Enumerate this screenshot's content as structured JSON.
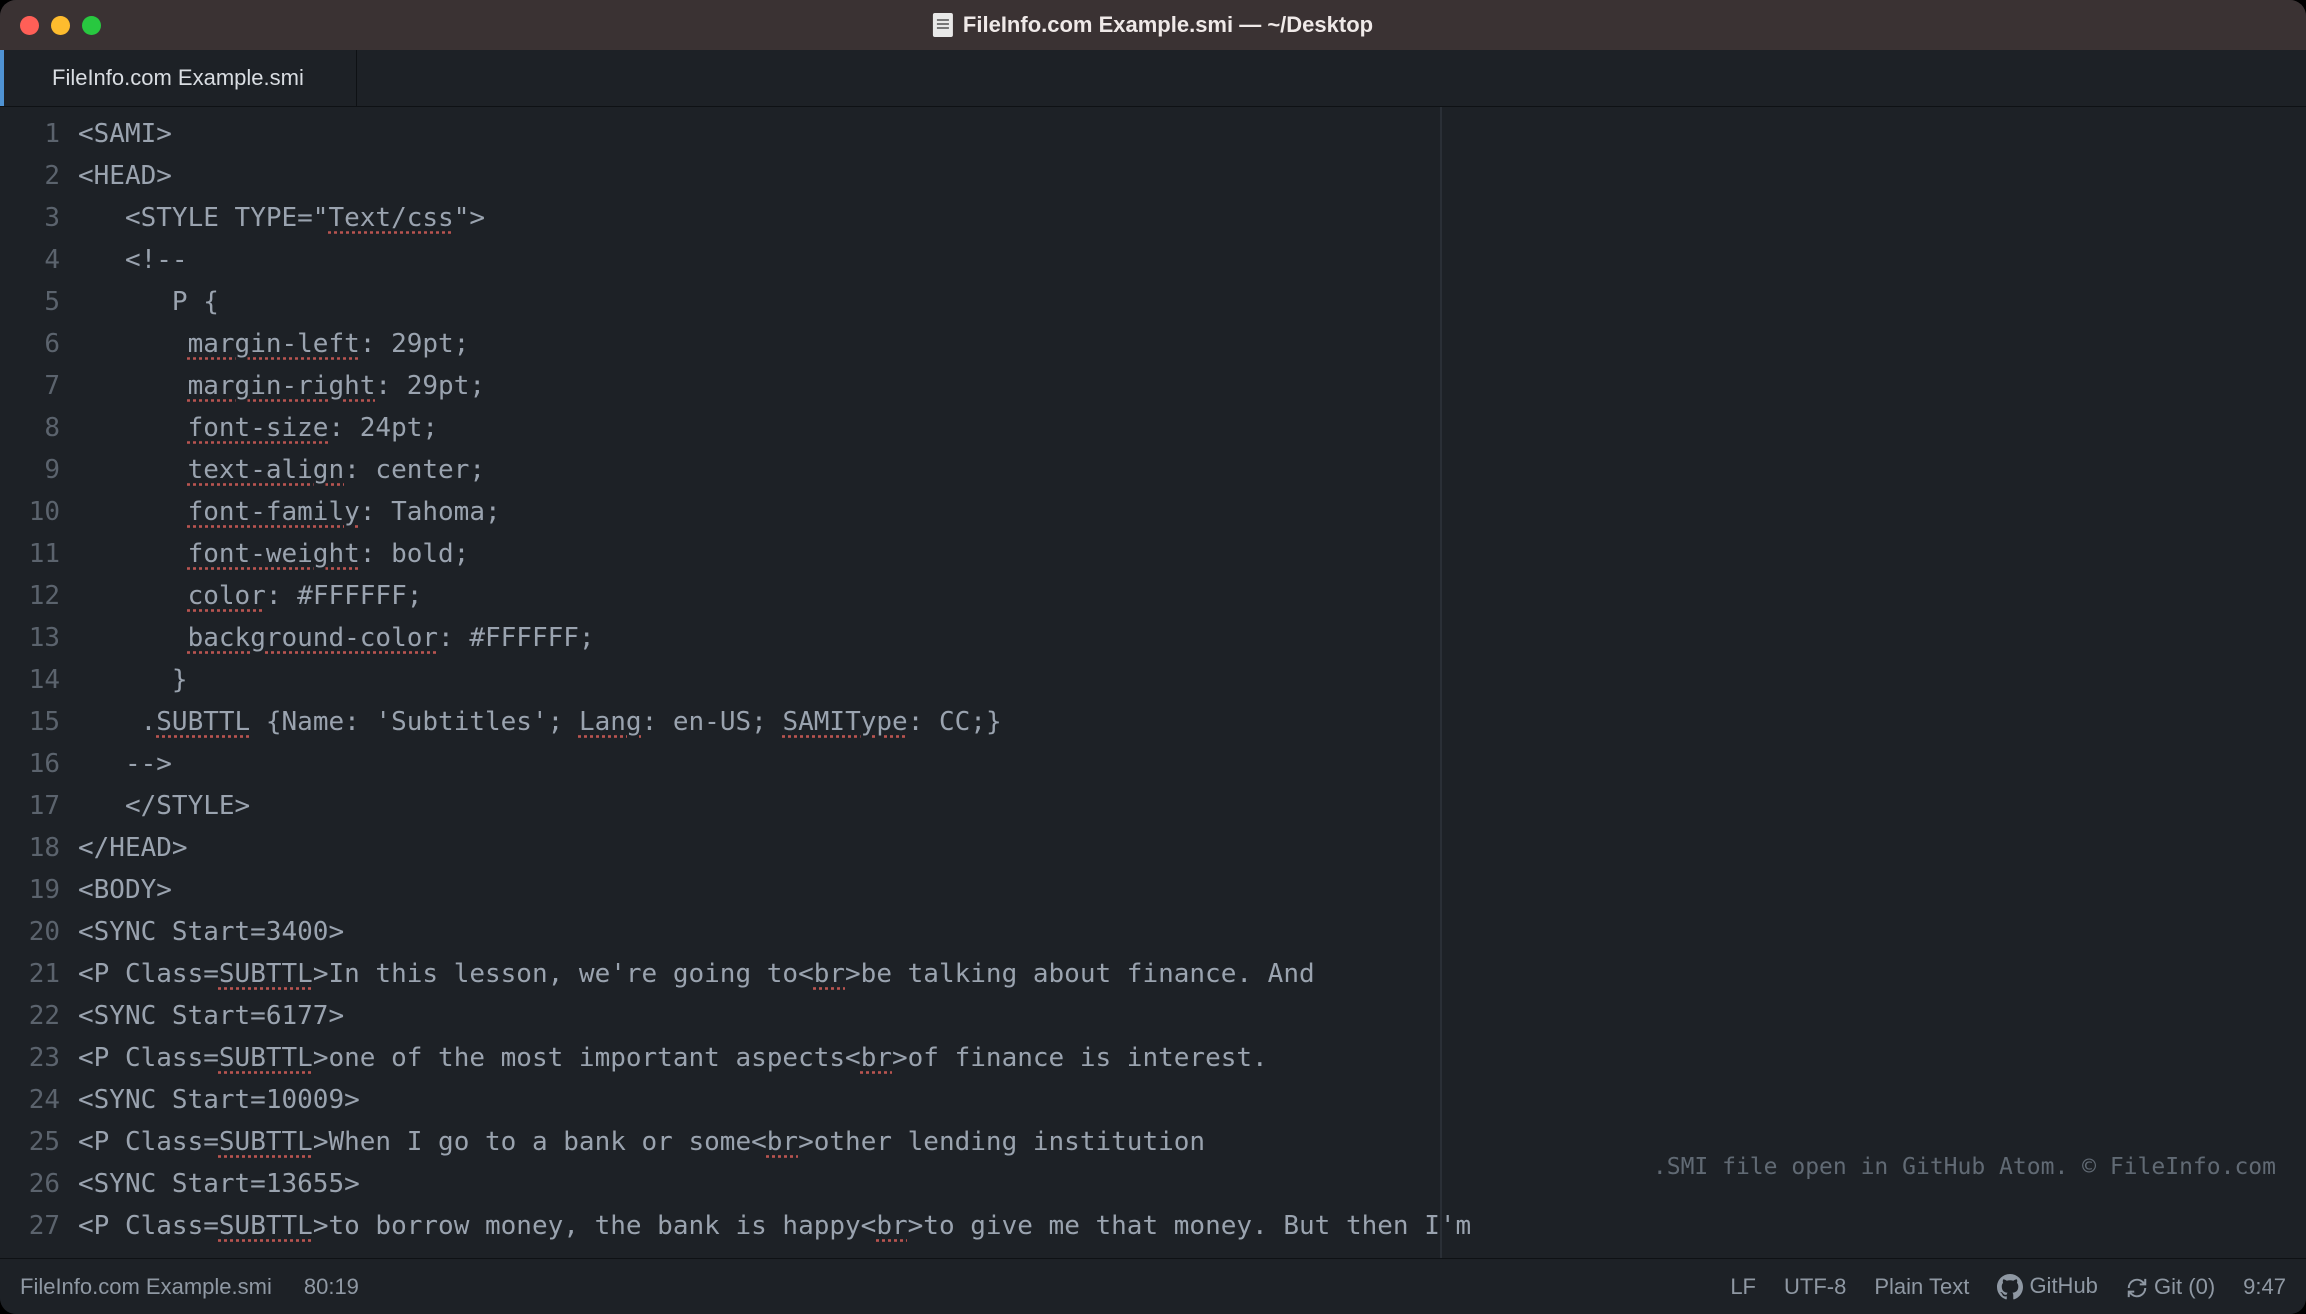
{
  "titlebar": {
    "title": "FileInfo.com Example.smi — ~/Desktop"
  },
  "tabs": [
    {
      "label": "FileInfo.com Example.smi",
      "active": true
    }
  ],
  "code": {
    "lines": [
      {
        "n": 1,
        "raw": "<SAMI>"
      },
      {
        "n": 2,
        "raw": "<HEAD>"
      },
      {
        "n": 3,
        "indent": "   ",
        "segs": [
          {
            "t": "<STYLE TYPE=\"",
            "u": false
          },
          {
            "t": "Text/css",
            "u": true
          },
          {
            "t": "\">",
            "u": false
          }
        ]
      },
      {
        "n": 4,
        "indent": "   ",
        "raw": "<!--"
      },
      {
        "n": 5,
        "indent": "      ",
        "raw": "P {"
      },
      {
        "n": 6,
        "indent": "       ",
        "segs": [
          {
            "t": "margin-left",
            "u": true
          },
          {
            "t": ": 29pt;",
            "u": false
          }
        ]
      },
      {
        "n": 7,
        "indent": "       ",
        "segs": [
          {
            "t": "margin-right",
            "u": true
          },
          {
            "t": ": 29pt;",
            "u": false
          }
        ]
      },
      {
        "n": 8,
        "indent": "       ",
        "segs": [
          {
            "t": "font-size",
            "u": true
          },
          {
            "t": ": 24pt;",
            "u": false
          }
        ]
      },
      {
        "n": 9,
        "indent": "       ",
        "segs": [
          {
            "t": "text-align",
            "u": true
          },
          {
            "t": ": center;",
            "u": false
          }
        ]
      },
      {
        "n": 10,
        "indent": "       ",
        "segs": [
          {
            "t": "font-family",
            "u": true
          },
          {
            "t": ": Tahoma;",
            "u": false
          }
        ]
      },
      {
        "n": 11,
        "indent": "       ",
        "segs": [
          {
            "t": "font-weight",
            "u": true
          },
          {
            "t": ": bold;",
            "u": false
          }
        ]
      },
      {
        "n": 12,
        "indent": "       ",
        "segs": [
          {
            "t": "color",
            "u": true
          },
          {
            "t": ": #FFFFFF;",
            "u": false
          }
        ]
      },
      {
        "n": 13,
        "indent": "       ",
        "segs": [
          {
            "t": "background-color",
            "u": true
          },
          {
            "t": ": #FFFFFF;",
            "u": false
          }
        ]
      },
      {
        "n": 14,
        "indent": "      ",
        "raw": "}"
      },
      {
        "n": 15,
        "indent": "    ",
        "segs": [
          {
            "t": ".",
            "u": false
          },
          {
            "t": "SUBTTL",
            "u": true
          },
          {
            "t": " {Name: 'Subtitles'; ",
            "u": false
          },
          {
            "t": "Lang",
            "u": true
          },
          {
            "t": ": en-US; ",
            "u": false
          },
          {
            "t": "SAMIType",
            "u": true
          },
          {
            "t": ": CC;}",
            "u": false
          }
        ]
      },
      {
        "n": 16,
        "indent": "   ",
        "raw": "-->"
      },
      {
        "n": 17,
        "indent": "   ",
        "raw": "</STYLE>"
      },
      {
        "n": 18,
        "raw": "</HEAD>"
      },
      {
        "n": 19,
        "raw": "<BODY>"
      },
      {
        "n": 20,
        "raw": "<SYNC Start=3400>"
      },
      {
        "n": 21,
        "segs": [
          {
            "t": "<P Class=",
            "u": false
          },
          {
            "t": "SUBTTL",
            "u": true
          },
          {
            "t": ">In this lesson, we're going to<",
            "u": false
          },
          {
            "t": "br",
            "u": true
          },
          {
            "t": ">be talking about finance. And",
            "u": false
          }
        ]
      },
      {
        "n": 22,
        "raw": "<SYNC Start=6177>"
      },
      {
        "n": 23,
        "segs": [
          {
            "t": "<P Class=",
            "u": false
          },
          {
            "t": "SUBTTL",
            "u": true
          },
          {
            "t": ">one of the most important aspects<",
            "u": false
          },
          {
            "t": "br",
            "u": true
          },
          {
            "t": ">of finance is interest.",
            "u": false
          }
        ]
      },
      {
        "n": 24,
        "raw": "<SYNC Start=10009>"
      },
      {
        "n": 25,
        "segs": [
          {
            "t": "<P Class=",
            "u": false
          },
          {
            "t": "SUBTTL",
            "u": true
          },
          {
            "t": ">When I go to a bank or some<",
            "u": false
          },
          {
            "t": "br",
            "u": true
          },
          {
            "t": ">other lending institution",
            "u": false
          }
        ]
      },
      {
        "n": 26,
        "raw": "<SYNC Start=13655>"
      },
      {
        "n": 27,
        "segs": [
          {
            "t": "<P Class=",
            "u": false
          },
          {
            "t": "SUBTTL",
            "u": true
          },
          {
            "t": ">to borrow money, the bank is happy<",
            "u": false
          },
          {
            "t": "br",
            "u": true
          },
          {
            "t": ">to give me that money. But then I'm",
            "u": false
          }
        ]
      }
    ]
  },
  "watermark": ".SMI file open in GitHub Atom. © FileInfo.com",
  "statusbar": {
    "filename": "FileInfo.com Example.smi",
    "cursor": "80:19",
    "line_ending": "LF",
    "encoding": "UTF-8",
    "grammar": "Plain Text",
    "github": "GitHub",
    "git": "Git (0)",
    "time": "9:47"
  }
}
